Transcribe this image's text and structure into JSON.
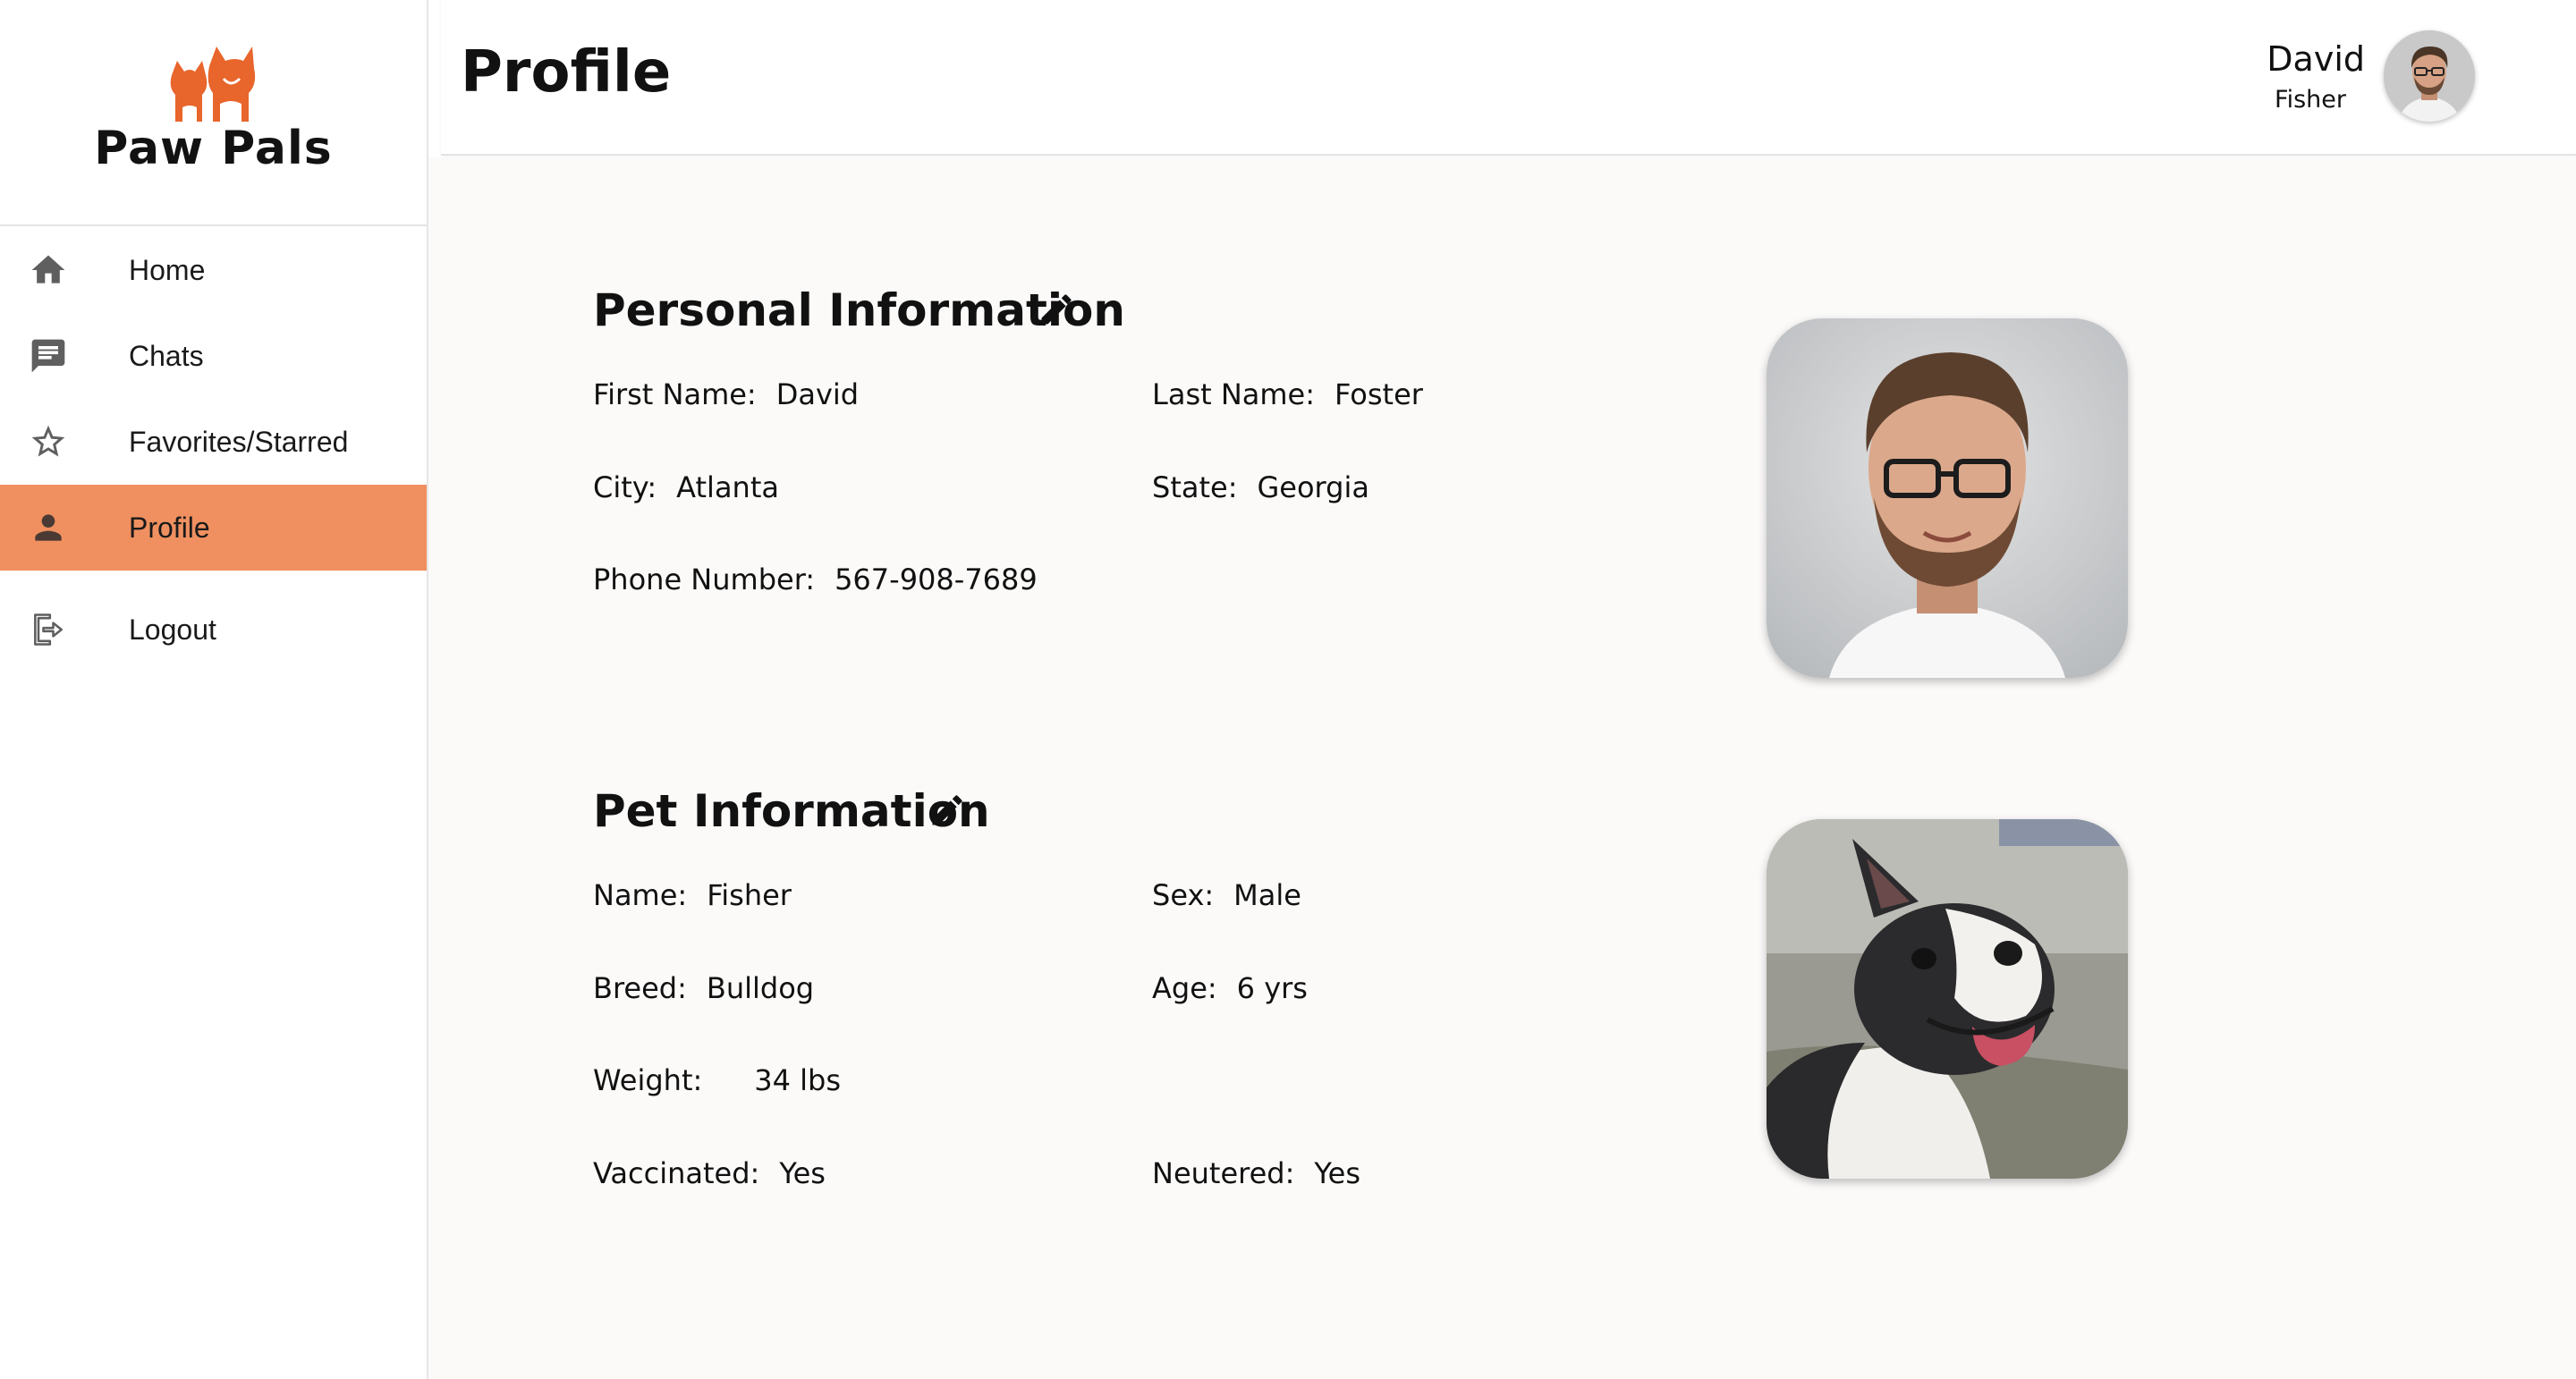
{
  "brand": {
    "name": "Paw Pals",
    "color": "#e8652b"
  },
  "nav": {
    "items": [
      {
        "label": "Home",
        "icon": "home-icon"
      },
      {
        "label": "Chats",
        "icon": "chat-icon"
      },
      {
        "label": "Favorites/Starred",
        "icon": "star-icon"
      },
      {
        "label": "Profile",
        "icon": "person-icon",
        "active": true
      },
      {
        "label": "Logout",
        "icon": "logout-icon"
      }
    ],
    "active_color": "#f09060"
  },
  "header": {
    "title": "Profile",
    "user": {
      "first_name": "David",
      "last_name": "Fisher"
    }
  },
  "personal": {
    "title": "Personal Information",
    "first_name": {
      "label": "First Name:",
      "value": "David"
    },
    "last_name": {
      "label": "Last Name:",
      "value": "Foster"
    },
    "city": {
      "label": "City:",
      "value": "Atlanta"
    },
    "state": {
      "label": "State:",
      "value": "Georgia"
    },
    "phone": {
      "label": "Phone Number:",
      "value": "567-908-7689"
    }
  },
  "pet": {
    "title": "Pet Information",
    "name": {
      "label": "Name:",
      "value": "Fisher"
    },
    "sex": {
      "label": "Sex:",
      "value": "Male"
    },
    "breed": {
      "label": "Breed:",
      "value": "Bulldog"
    },
    "age": {
      "label": "Age:",
      "value": "6 yrs"
    },
    "weight": {
      "label": "Weight:",
      "value": "34 lbs"
    },
    "vaccinated": {
      "label": "Vaccinated:",
      "value": "Yes"
    },
    "neutered": {
      "label": "Neutered:",
      "value": "Yes"
    }
  }
}
